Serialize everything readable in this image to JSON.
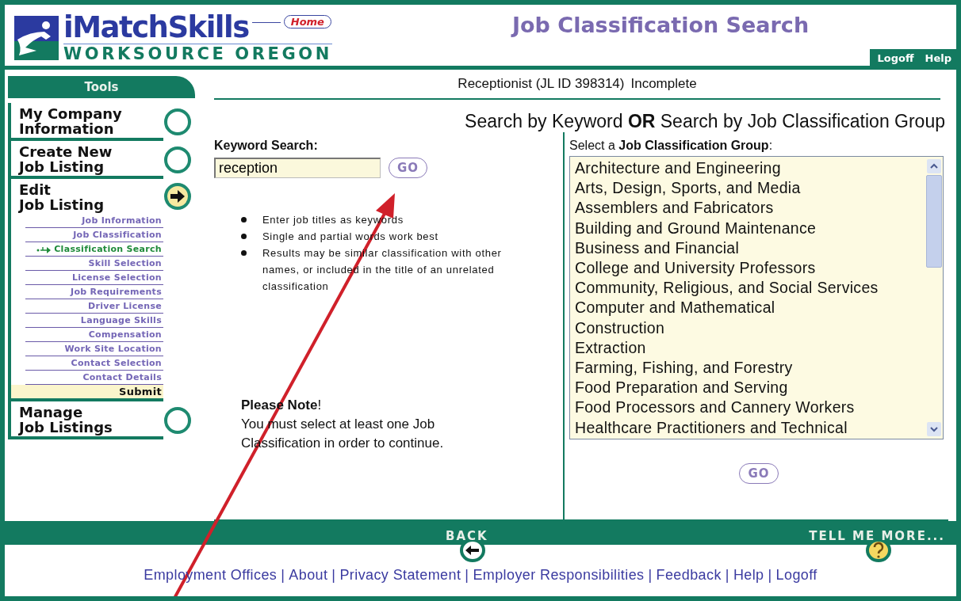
{
  "header": {
    "brand": "iMatchSkills",
    "brand_subtitle": "WORKSOURCE OREGON",
    "home": "Home",
    "page_title": "Job Classification Search",
    "top_links": [
      "Logoff",
      "Help"
    ]
  },
  "sidebar": {
    "title": "Tools",
    "sections": [
      {
        "lines": [
          "My Company",
          "Information"
        ],
        "current": false
      },
      {
        "lines": [
          "Create New",
          "Job Listing"
        ],
        "current": false
      },
      {
        "lines": [
          "Edit",
          "Job Listing"
        ],
        "current": true,
        "children": [
          {
            "label": "Job Information",
            "kind": "link",
            "selected": false
          },
          {
            "label": "Job Classification",
            "kind": "link",
            "selected": false
          },
          {
            "label": "Classification Search",
            "kind": "link",
            "selected": true
          },
          {
            "label": "Skill Selection",
            "kind": "link",
            "selected": false
          },
          {
            "label": "License Selection",
            "kind": "link",
            "selected": false
          },
          {
            "label": "Job Requirements",
            "kind": "link",
            "selected": false
          },
          {
            "label": "Driver License",
            "kind": "link",
            "selected": false
          },
          {
            "label": "Language Skills",
            "kind": "link",
            "selected": false
          },
          {
            "label": "Compensation",
            "kind": "link",
            "selected": false
          },
          {
            "label": "Work Site Location",
            "kind": "link",
            "selected": false
          },
          {
            "label": "Contact Selection",
            "kind": "link",
            "selected": false
          },
          {
            "label": "Contact Details",
            "kind": "link",
            "selected": false
          },
          {
            "label": "Submit",
            "kind": "submit",
            "selected": false
          }
        ]
      },
      {
        "lines": [
          "Manage",
          "Job Listings"
        ],
        "current": false
      }
    ]
  },
  "listing": {
    "job": "Receptionist (JL ID 398314)",
    "status": "Incomplete"
  },
  "heading": "Search by Keyword **OR** Search by Job Classification Group",
  "keyword_search": {
    "label": "Keyword Search:",
    "value": "reception",
    "button": "GO",
    "tips": [
      "Enter job titles as keywords",
      "Single and partial words work best",
      "Results may be similar classification with other names, or included in the title of an unrelated classification"
    ],
    "note_title": "**Please Note**!",
    "note": "You must select at least one Job Classification in order to continue."
  },
  "group_search": {
    "label": "Select a **Job Classification Group**:",
    "button": "GO",
    "options": [
      "Architecture and Engineering",
      "Arts, Design, Sports, and Media",
      "Assemblers and Fabricators",
      "Building and Ground Maintenance",
      "Business and Financial",
      "College and University Professors",
      "Community, Religious, and Social Services",
      "Computer and Mathematical",
      "Construction",
      "Extraction",
      "Farming, Fishing, and Forestry",
      "Food Preparation and Serving",
      "Food Processors and Cannery Workers",
      "Healthcare Practitioners and Technical"
    ]
  },
  "footer": {
    "back": "BACK",
    "more": "TELL ME MORE...",
    "separator": "|",
    "links": [
      "Employment Offices",
      "About",
      "Privacy Statement",
      "Employer Responsibilities",
      "Feedback",
      "Help",
      "Logoff"
    ]
  }
}
